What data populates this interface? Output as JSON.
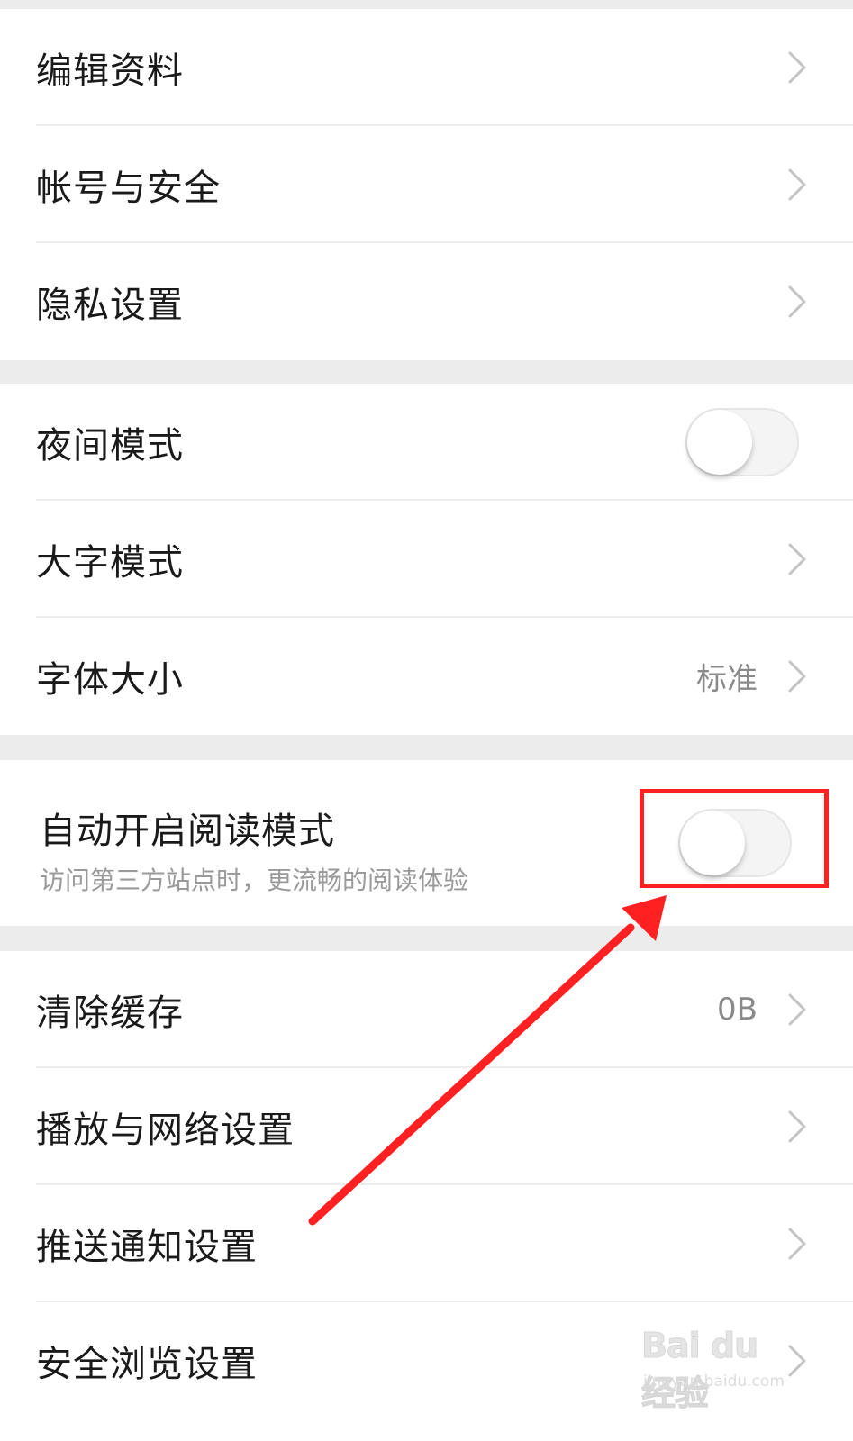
{
  "settings": {
    "group1": [
      {
        "label": "编辑资料",
        "icon": "chevron-right-icon"
      },
      {
        "label": "帐号与安全",
        "icon": "chevron-right-icon"
      },
      {
        "label": "隐私设置",
        "icon": "chevron-right-icon"
      }
    ],
    "group2": {
      "night_mode": {
        "label": "夜间模式",
        "enabled": false
      },
      "large_font": {
        "label": "大字模式",
        "icon": "chevron-right-icon"
      },
      "font_size": {
        "label": "字体大小",
        "value": "标准",
        "icon": "chevron-right-icon"
      }
    },
    "group3": {
      "auto_reader": {
        "label": "自动开启阅读模式",
        "description": "访问第三方站点时，更流畅的阅读体验",
        "enabled": false
      }
    },
    "group4": {
      "clear_cache": {
        "label": "清除缓存",
        "value": "0B",
        "icon": "chevron-right-icon"
      },
      "playback_network": {
        "label": "播放与网络设置",
        "icon": "chevron-right-icon"
      },
      "push_notification": {
        "label": "推送通知设置",
        "icon": "chevron-right-icon"
      },
      "safe_browsing": {
        "label": "安全浏览设置",
        "icon": "chevron-right-icon"
      }
    }
  },
  "watermark": {
    "main": "Bai du 经验",
    "sub": "jingyan.baidu.com"
  },
  "colors": {
    "annotation": "#ff2121",
    "background": "#ececec",
    "card": "#ffffff"
  }
}
